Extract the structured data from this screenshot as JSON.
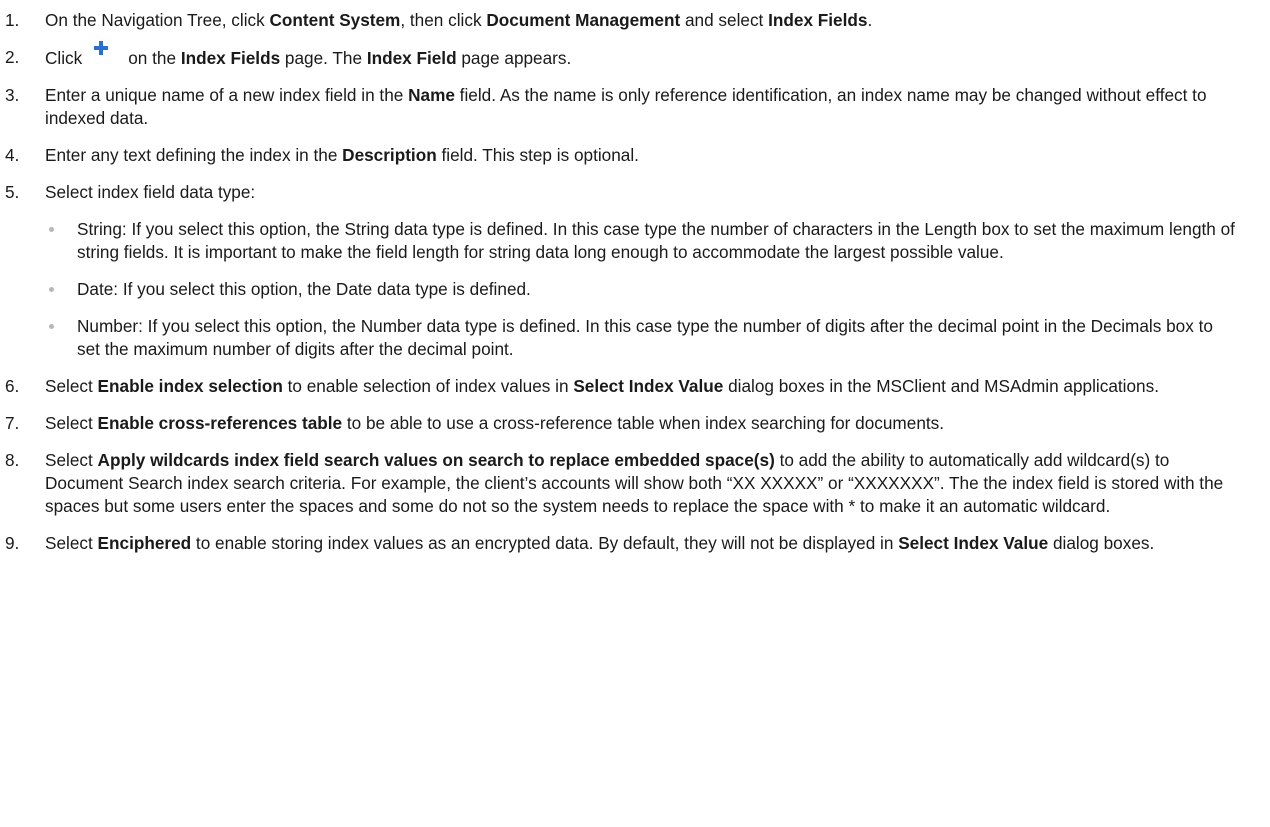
{
  "steps": {
    "s1": {
      "num": "1.",
      "t1": "On the Navigation Tree, click ",
      "b1": "Content System",
      "t2": ", then click ",
      "b2": "Document Management",
      "t3": " and select ",
      "b3": "Index Fields",
      "t4": "."
    },
    "s2": {
      "num": "2.",
      "t1": "Click",
      "icon": "plus-icon",
      "t2": "on the ",
      "b1": "Index Fields",
      "t3": " page. The ",
      "b2": "Index Field",
      "t4": " page appears."
    },
    "s3": {
      "num": "3.",
      "t1": "Enter a unique name of a new index field in the ",
      "b1": "Name",
      "t2": " field. As the name is only reference identification, an index name may be changed without effect to indexed data."
    },
    "s4": {
      "num": "4.",
      "t1": "Enter any text defining the index in the ",
      "b1": "Description",
      "t2": " field. This step is optional."
    },
    "s5": {
      "num": "5.",
      "t1": "Select index field data type:",
      "bullets": [
        "String: If you select this option, the String data type is defined. In this case type the number of characters in the Length box to set the maximum length of string fields. It is important to make the field length for string data long enough to accommodate the largest possible value.",
        "Date: If you select this option, the Date data type is defined.",
        "Number: If you select this option, the Number data type is defined. In this case  type the number of digits after the decimal point in the Decimals box to set the maximum number of digits after the decimal point."
      ]
    },
    "s6": {
      "num": "6.",
      "t1": " Select ",
      "b1": "Enable index selection",
      "t2": " to  enable selection of index values in ",
      "b2": "Select Index Value",
      "t3": " dialog boxes in the MSClient and MSAdmin applications."
    },
    "s7": {
      "num": "7.",
      "t1": "Select ",
      "b1": "Enable cross-references table",
      "t2": " to be able to use a cross-reference table when index searching for documents."
    },
    "s8": {
      "num": "8.",
      "t1": "Select ",
      "b1": "Apply wildcards index field search values on search to replace embedded space(s)",
      "t2": " to add the ability to automatically add wildcard(s) to Document Search index search criteria. For example, the client’s accounts will show both “XX XXXXX” or “XXXXXXX”. The the index field is stored with the spaces but some users enter the spaces and some do not so the system needs to replace the space with * to make it an automatic wildcard."
    },
    "s9": {
      "num": "9.",
      "t1": "Select ",
      "b1": "Enciphered",
      "t2": " to enable storing index values as an encrypted data. By default, they will not be displayed in ",
      "b2": "Select Index Value",
      "t3": " dialog boxes."
    }
  },
  "colors": {
    "text": "#1a1a1a",
    "bullet": "#b7b7b7",
    "icon_plus": "#2a6fd6"
  }
}
